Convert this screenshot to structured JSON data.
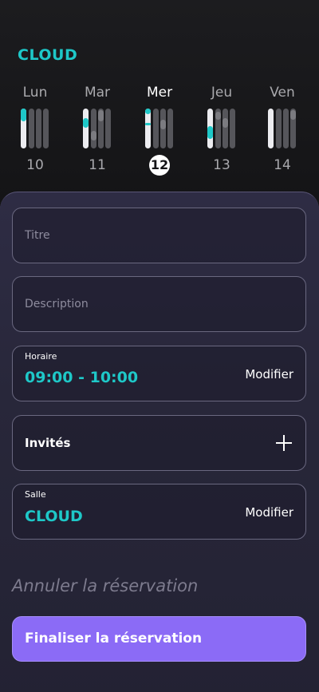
{
  "room": {
    "name": "CLOUD"
  },
  "week": {
    "days": [
      {
        "name": "Lun",
        "num": "10"
      },
      {
        "name": "Mar",
        "num": "11"
      },
      {
        "name": "Mer",
        "num": "12"
      },
      {
        "name": "Jeu",
        "num": "13"
      },
      {
        "name": "Ven",
        "num": "14"
      }
    ],
    "selected_index": 2
  },
  "form": {
    "title_placeholder": "Titre",
    "description_placeholder": "Description",
    "schedule": {
      "label": "Horaire",
      "value": "09:00 - 10:00",
      "action": "Modifier"
    },
    "guests": {
      "label": "Invités"
    },
    "room": {
      "label": "Salle",
      "value": "CLOUD",
      "action": "Modifier"
    }
  },
  "actions": {
    "cancel": "Annuler la réservation",
    "finalize": "Finaliser la réservation"
  },
  "colors": {
    "accent": "#1ec8c8",
    "primary_button": "#8b6bf6",
    "background": "#141416",
    "panel": "#2e2c44"
  }
}
